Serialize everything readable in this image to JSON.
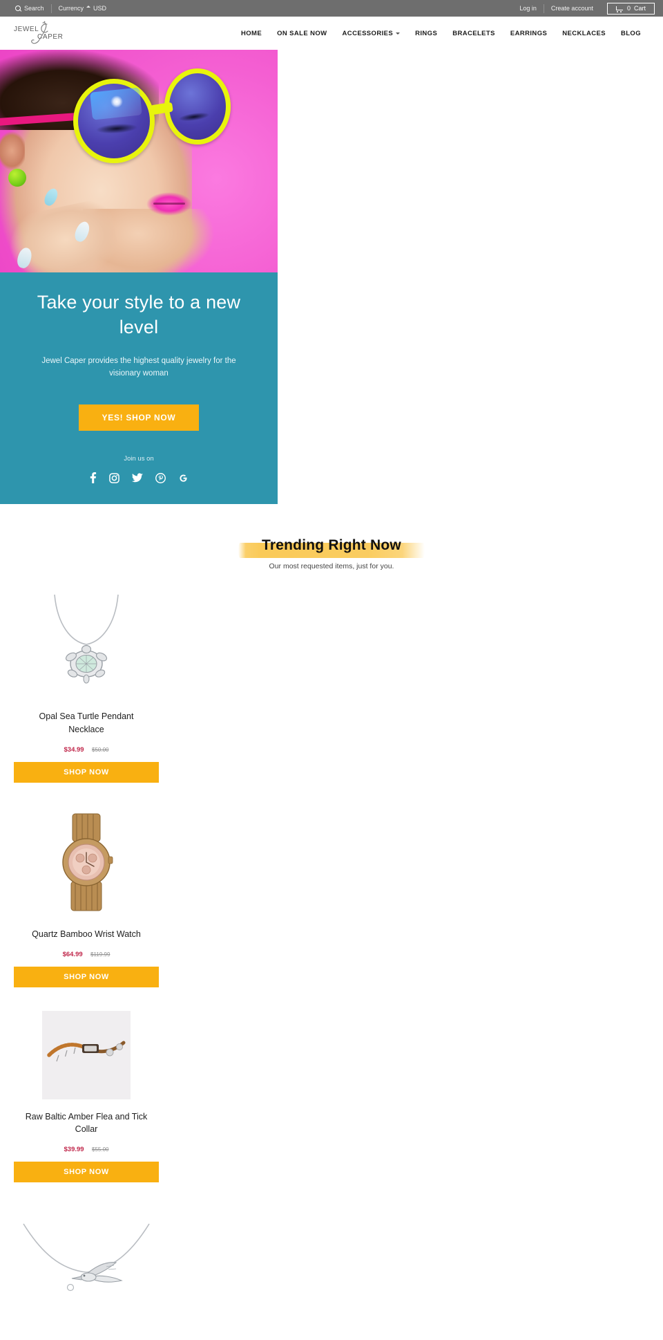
{
  "topbar": {
    "search_label": "Search",
    "search_icon": "search-icon",
    "currency_label": "Currency",
    "currency_value": "USD",
    "login_label": "Log in",
    "create_account_label": "Create account",
    "cart_icon": "cart-icon",
    "cart_count": "0",
    "cart_label": "Cart",
    "bg_color": "#6e6e6e"
  },
  "header": {
    "logo_line1": "JEWEL",
    "logo_line2": "CAPER",
    "logo_monogram": "jc",
    "nav": [
      {
        "label": "HOME",
        "has_caret": false
      },
      {
        "label": "ON SALE NOW",
        "has_caret": false
      },
      {
        "label": "ACCESSORIES",
        "has_caret": true
      },
      {
        "label": "RINGS",
        "has_caret": false
      },
      {
        "label": "BRACELETS",
        "has_caret": false
      },
      {
        "label": "EARRINGS",
        "has_caret": false
      },
      {
        "label": "NECKLACES",
        "has_caret": false
      },
      {
        "label": "BLOG",
        "has_caret": false
      }
    ]
  },
  "hero": {
    "image_alt": "Woman wearing large yellow round sunglasses on pink background",
    "title": "Take your style to a new level",
    "subtitle": "Jewel Caper provides the highest quality jewelry for the visionary woman",
    "cta_label": "YES! SHOP NOW",
    "join_label": "Join us on",
    "panel_color": "#2e95ad",
    "cta_color": "#f9b011",
    "socials": [
      {
        "name": "facebook-icon"
      },
      {
        "name": "instagram-icon"
      },
      {
        "name": "twitter-icon"
      },
      {
        "name": "pinterest-icon"
      },
      {
        "name": "google-icon"
      }
    ]
  },
  "trending": {
    "title": "Trending Right Now",
    "subtitle": "Our most requested items, just for you.",
    "highlight_color": "#fac74f"
  },
  "products": [
    {
      "title": "Opal Sea Turtle Pendant Necklace",
      "sale_price": "$34.99",
      "original_price": "$50.00",
      "button_label": "SHOP NOW",
      "image_type": "turtle-pendant-necklace"
    },
    {
      "title": "Quartz Bamboo Wrist Watch",
      "sale_price": "$64.99",
      "original_price": "$119.99",
      "button_label": "SHOP NOW",
      "image_type": "bamboo-wrist-watch"
    },
    {
      "title": "Raw Baltic Amber Flea and Tick Collar",
      "sale_price": "$39.99",
      "original_price": "$55.00",
      "button_label": "SHOP NOW",
      "image_type": "amber-collar"
    },
    {
      "title": "",
      "sale_price": "",
      "original_price": "",
      "button_label": "",
      "image_type": "hummingbird-necklace"
    }
  ]
}
